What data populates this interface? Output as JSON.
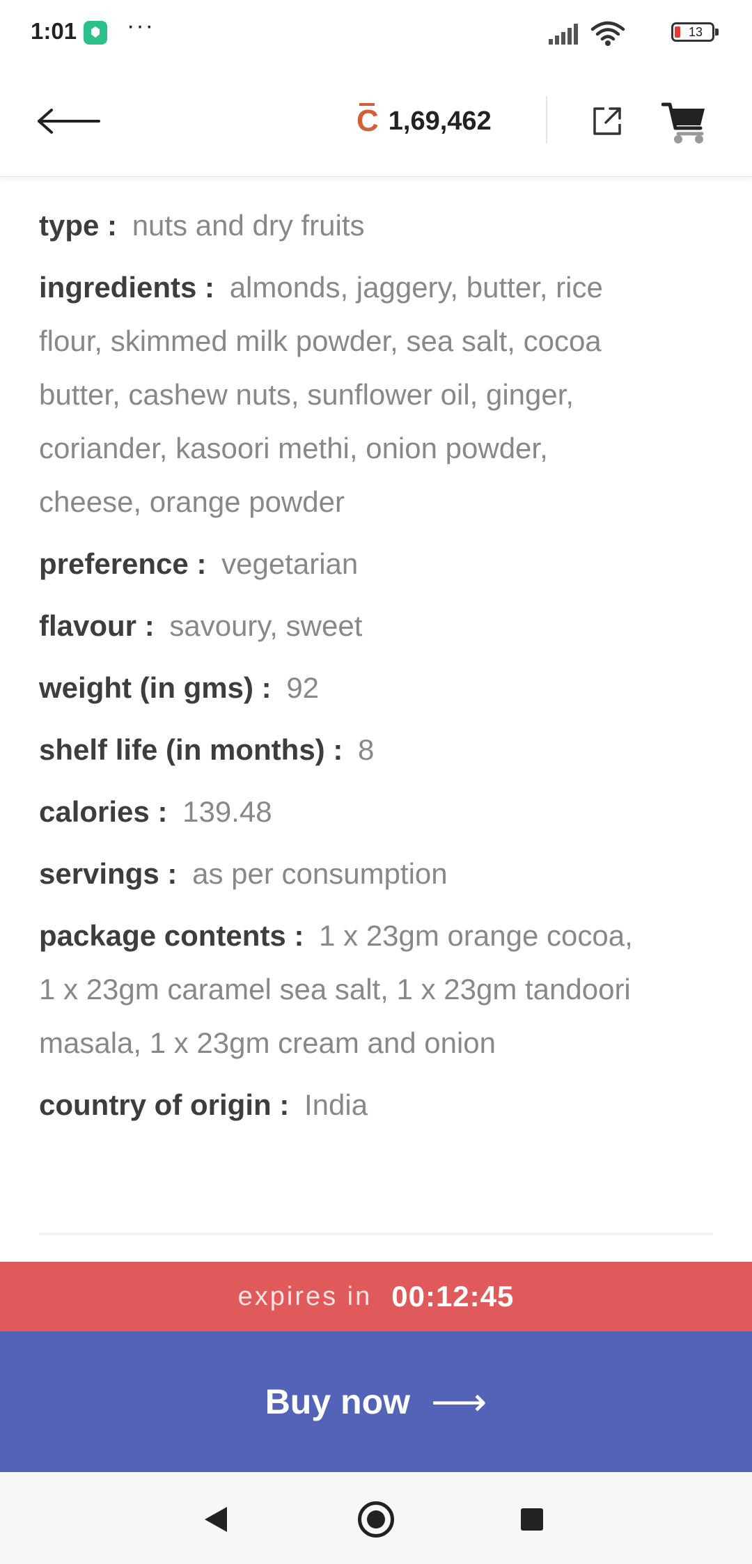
{
  "status_bar": {
    "time": "1:01",
    "dots": "···",
    "battery": "13"
  },
  "header": {
    "coin_balance": "1,69,462",
    "coin_symbol": "C"
  },
  "details": [
    {
      "label": "type",
      "value": "nuts and dry fruits"
    },
    {
      "label": "ingredients",
      "value": "almonds, jaggery, butter, rice flour, skimmed milk powder, sea salt, cocoa butter, cashew nuts, sunflower oil, ginger, coriander, kasoori methi, onion powder, cheese, orange powder"
    },
    {
      "label": "preference",
      "value": "vegetarian"
    },
    {
      "label": "flavour",
      "value": "savoury, sweet"
    },
    {
      "label": "weight (in gms)",
      "value": "92"
    },
    {
      "label": "shelf life (in months)",
      "value": "8"
    },
    {
      "label": "calories",
      "value": "139.48"
    },
    {
      "label": "servings",
      "value": "as per consumption"
    },
    {
      "label": "package contents",
      "value": "1 x 23gm orange cocoa, 1 x 23gm caramel sea salt, 1 x 23gm tandoori masala, 1 x 23gm cream and onion"
    },
    {
      "label": "country of origin",
      "value": "India"
    }
  ],
  "expiry": {
    "label": "expires in",
    "time": "00:12:45"
  },
  "buy": {
    "label": "Buy now",
    "arrow": "⟶"
  },
  "colors": {
    "accent_coin": "#d35f3a",
    "expiry_bg": "#e05a5b",
    "buy_bg": "#5363b8"
  }
}
